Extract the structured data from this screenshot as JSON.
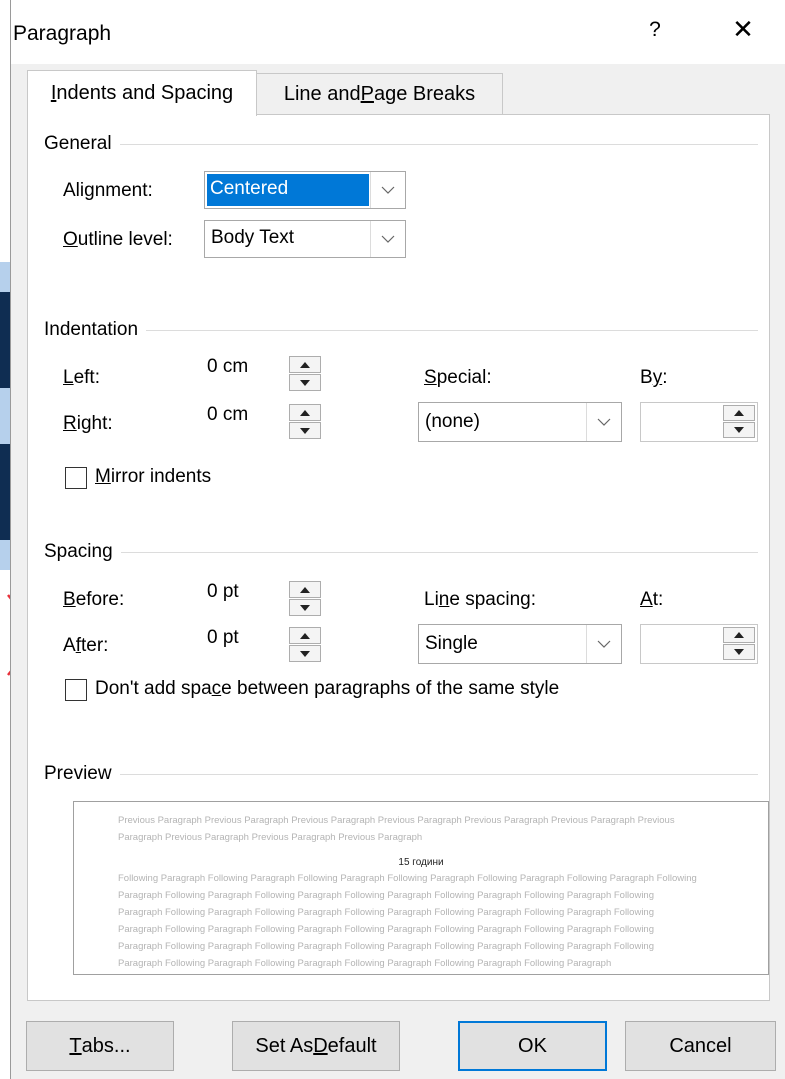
{
  "dialog": {
    "title": "Paragraph",
    "help": "?",
    "close": "✕"
  },
  "tabs": [
    {
      "pre": "",
      "mnemonic": "I",
      "post": "ndents and Spacing",
      "active": true
    },
    {
      "pre": "Line and ",
      "mnemonic": "P",
      "post": "age Breaks",
      "active": false
    }
  ],
  "general": {
    "heading": "General",
    "alignment": {
      "pre": "Ali",
      "mnemonic": "g",
      "post": "nment:",
      "value": "Centered"
    },
    "outline_level": {
      "pre": "",
      "mnemonic": "O",
      "post": "utline level:",
      "value": "Body Text"
    }
  },
  "indentation": {
    "heading": "Indentation",
    "left": {
      "pre": "",
      "mnemonic": "L",
      "post": "eft:",
      "value": "0 cm"
    },
    "right": {
      "pre": "",
      "mnemonic": "R",
      "post": "ight:",
      "value": "0 cm"
    },
    "special": {
      "pre": "",
      "mnemonic": "S",
      "post": "pecial:",
      "value": "(none)"
    },
    "by": {
      "pre": "B",
      "mnemonic": "y",
      "post": ":",
      "value": ""
    },
    "mirror": {
      "pre": "",
      "mnemonic": "M",
      "post": "irror indents",
      "checked": false
    }
  },
  "spacing": {
    "heading": "Spacing",
    "before": {
      "pre": "",
      "mnemonic": "B",
      "post": "efore:",
      "value": "0 pt"
    },
    "after": {
      "pre": "A",
      "mnemonic": "f",
      "post": "ter:",
      "value": "0 pt"
    },
    "line_spacing": {
      "pre": "Li",
      "mnemonic": "n",
      "post": "e spacing:",
      "value": "Single"
    },
    "at": {
      "pre": "",
      "mnemonic": "A",
      "post": "t:",
      "value": ""
    },
    "dont_add": {
      "pre": "Don't add spa",
      "mnemonic": "c",
      "post": "e between paragraphs of the same style",
      "checked": false
    }
  },
  "preview": {
    "heading": "Preview",
    "previous_text": "Previous Paragraph Previous Paragraph Previous Paragraph Previous Paragraph Previous Paragraph Previous Paragraph Previous Paragraph Previous Paragraph Previous Paragraph Previous Paragraph",
    "current_text": "15 години",
    "following_text": "Following Paragraph Following Paragraph Following Paragraph Following Paragraph Following Paragraph Following Paragraph Following Paragraph Following Paragraph Following Paragraph Following Paragraph Following Paragraph Following Paragraph Following Paragraph Following Paragraph Following Paragraph Following Paragraph Following Paragraph Following Paragraph Following Paragraph Following Paragraph Following Paragraph Following Paragraph Following Paragraph Following Paragraph Following Paragraph Following Paragraph Following Paragraph Following Paragraph Following Paragraph Following Paragraph Following Paragraph Following Paragraph Following Paragraph Following Paragraph Following Paragraph Following Paragraph"
  },
  "buttons": {
    "tabs": {
      "pre": "",
      "mnemonic": "T",
      "post": "abs..."
    },
    "set_default": {
      "pre": "Set As ",
      "mnemonic": "D",
      "post": "efault"
    },
    "ok": "OK",
    "cancel": "Cancel"
  },
  "colors": {
    "selection": "#0078d7",
    "dialog_bg": "#f0f0f0",
    "annotation_arrow": "#e8303a"
  },
  "icons": {
    "dropdown": "chevron-down-icon",
    "spin_up": "spin-up-icon",
    "spin_down": "spin-down-icon",
    "close": "close-icon"
  }
}
